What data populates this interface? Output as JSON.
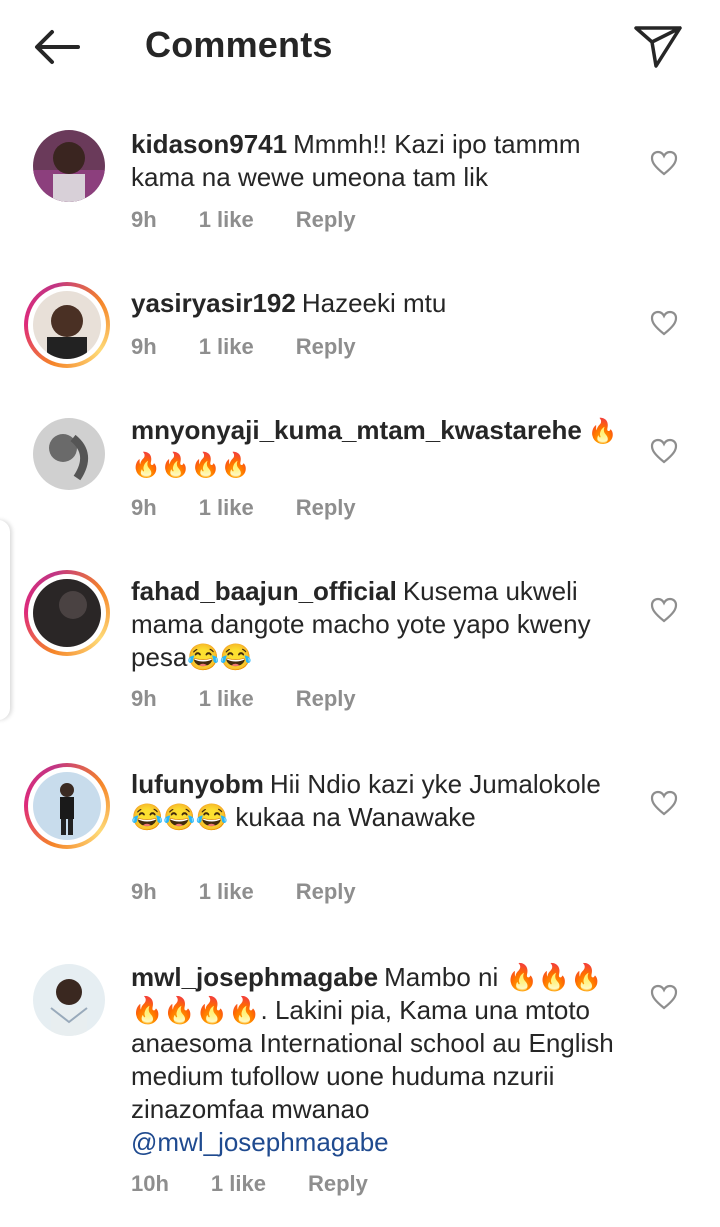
{
  "header": {
    "title": "Comments"
  },
  "colors": {
    "text": "#262626",
    "meta": "#8e8e8e",
    "mention": "#1f4a8f",
    "story_ring": "#dd2a7b"
  },
  "comments": [
    {
      "username": "kidason9741",
      "text": "Mmmh!! Kazi ipo tammm kama na wewe umeona tam lik",
      "time": "9h",
      "likes": "1 like",
      "reply": "Reply"
    },
    {
      "username": "yasiryasir192",
      "text": "Hazeeki mtu",
      "time": "9h",
      "likes": "1 like",
      "reply": "Reply"
    },
    {
      "username": "mnyonyaji_kuma_mtam_kwastarehe",
      "text": "🔥 🔥🔥🔥🔥",
      "time": "9h",
      "likes": "1 like",
      "reply": "Reply"
    },
    {
      "username": "fahad_baajun_official",
      "text": "Kusema ukweli mama dangote macho yote yapo kweny pesa😂😂",
      "time": "9h",
      "likes": "1 like",
      "reply": "Reply"
    },
    {
      "username": "lufunyobm",
      "text": "Hii Ndio kazi yke Jumalokole😂😂😂 kukaa na Wanawake",
      "time": "9h",
      "likes": "1 like",
      "reply": "Reply"
    },
    {
      "username": "mwl_josephmagabe",
      "text": "Mambo ni 🔥🔥🔥🔥🔥🔥🔥. Lakini pia, Kama una mtoto anaesoma International school au English medium tufollow uone huduma nzurii zinazomfaa mwanao",
      "mention": "@mwl_josephmagabe",
      "time": "10h",
      "likes": "1 like",
      "reply": "Reply"
    }
  ]
}
